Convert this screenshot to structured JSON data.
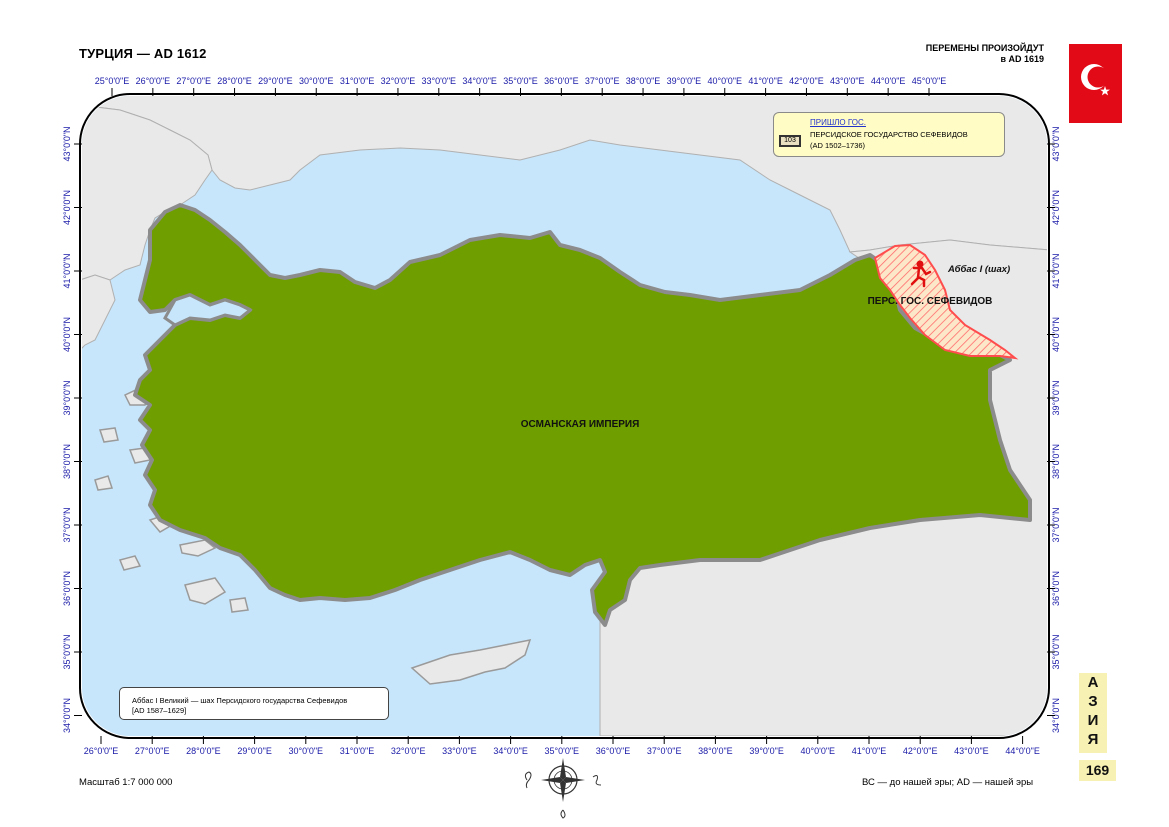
{
  "page": {
    "title": "ТУРЦИЯ — AD 1612",
    "changes_line1": "ПЕРЕМЕНЫ ПРОИЗОЙДУТ",
    "changes_line2": "в AD 1619",
    "scale": "Масштаб 1:7 000 000",
    "era_note": "ВС — до нашей эры; AD — нашей эры",
    "region_letters": [
      "А",
      "З",
      "И",
      "Я"
    ],
    "page_number": "169"
  },
  "legend": {
    "title": "ПРИШЛО ГОС.",
    "badge": "103",
    "line1": "ПЕРСИДСКОЕ ГОСУДАРСТВО СЕФЕВИДОВ",
    "line2": "(AD 1502–1736)"
  },
  "note": {
    "line1": "Аббас I Великий — шах Персидского государства Сефевидов",
    "line2": "[AD 1587–1629]"
  },
  "map_labels": {
    "ottoman": "ОСМАНСКАЯ ИМПЕРИЯ",
    "safavid": "ПЕРС. ГОС. СЕФЕВИДОВ",
    "abbas": "Аббас I (шах)"
  },
  "axes": {
    "top_lon": [
      "25°0'0\"E",
      "26°0'0\"E",
      "27°0'0\"E",
      "28°0'0\"E",
      "29°0'0\"E",
      "30°0'0\"E",
      "31°0'0\"E",
      "32°0'0\"E",
      "33°0'0\"E",
      "34°0'0\"E",
      "35°0'0\"E",
      "36°0'0\"E",
      "37°0'0\"E",
      "38°0'0\"E",
      "39°0'0\"E",
      "40°0'0\"E",
      "41°0'0\"E",
      "42°0'0\"E",
      "43°0'0\"E",
      "44°0'0\"E",
      "45°0'0\"E"
    ],
    "bottom_lon": [
      "26°0'0\"E",
      "27°0'0\"E",
      "28°0'0\"E",
      "29°0'0\"E",
      "30°0'0\"E",
      "31°0'0\"E",
      "32°0'0\"E",
      "33°0'0\"E",
      "34°0'0\"E",
      "35°0'0\"E",
      "36°0'0\"E",
      "37°0'0\"E",
      "38°0'0\"E",
      "39°0'0\"E",
      "40°0'0\"E",
      "41°0'0\"E",
      "42°0'0\"E",
      "43°0'0\"E",
      "44°0'0\"E"
    ],
    "lat": [
      "43°0'0\"N",
      "42°0'0\"N",
      "41°0'0\"N",
      "40°0'0\"N",
      "39°0'0\"N",
      "38°0'0\"N",
      "37°0'0\"N",
      "36°0'0\"N",
      "35°0'0\"N",
      "34°0'0\"N"
    ]
  },
  "colors": {
    "sea": "#c7e6fb",
    "land_other": "#e9e9e9",
    "ottoman": "#6f9e00",
    "safavid_hatch": "#ff6b6b",
    "safavid_fill": "#fde7c9",
    "border": "#8c8c8c",
    "flag_red": "#e30a17"
  }
}
